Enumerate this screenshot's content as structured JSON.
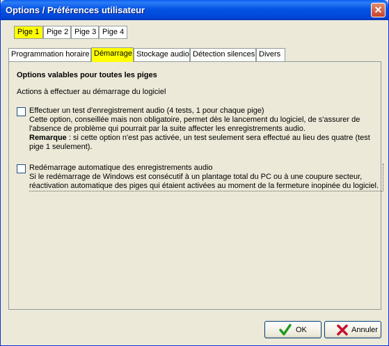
{
  "window": {
    "title": "Options / Préférences utilisateur",
    "close_symbol": "✕"
  },
  "top_tabs": [
    {
      "label": "Pige 1",
      "selected": true
    },
    {
      "label": "Pige 2",
      "selected": false
    },
    {
      "label": "Pige 3",
      "selected": false
    },
    {
      "label": "Pige 4",
      "selected": false
    }
  ],
  "sub_tabs": [
    {
      "label": "Programmation horaire",
      "selected": false
    },
    {
      "label": "Démarrage",
      "selected": true
    },
    {
      "label": "Stockage audio",
      "selected": false
    },
    {
      "label": "Détection silences",
      "selected": false
    },
    {
      "label": "Divers",
      "selected": false
    }
  ],
  "panel": {
    "section_title": "Options valables pour toutes les piges",
    "actions_label": "Actions à effectuer au démarrage du logiciel",
    "option1": {
      "checked": false,
      "label": "Effectuer un test d'enregistrement audio (4 tests, 1 pour chaque pige)",
      "description": "Cette option, conseillée mais non obligatoire, permet dès le lancement du logiciel, de s'assurer de l'absence de problème qui pourrait par la suite affecter les enregistrements audio.",
      "remark_label": "Remarque",
      "remark_text": " : si cette option n'est pas activée, un test seulement sera effectué au lieu des quatre (test pige 1 seulement)."
    },
    "option2": {
      "checked": false,
      "label": "Redémarrage automatique des enregistrements audio",
      "description": "Si le redémarrage de Windows est consécutif à un plantage total du PC ou à une coupure secteur, réactivation automatique des piges qui étaient activées au moment de la fermeture inopinée du logiciel."
    }
  },
  "buttons": {
    "ok": "OK",
    "cancel": "Annuler"
  },
  "colors": {
    "selected_tab": "#ffff00",
    "ok_icon": "#1c9a1c",
    "cancel_icon": "#c8102e",
    "titlebar": "#0054e3"
  }
}
